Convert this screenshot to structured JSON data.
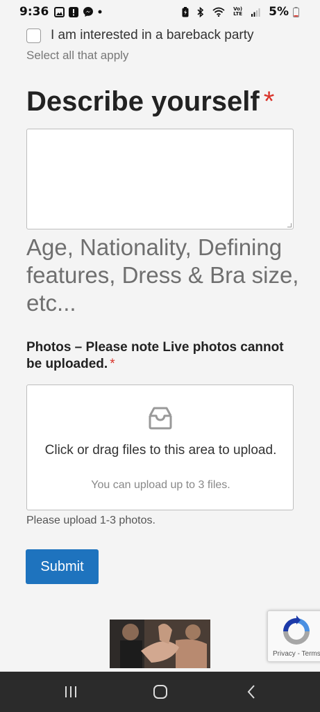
{
  "status_bar": {
    "time": "9:36",
    "lte": "Vo)\nLTE",
    "battery": "5%",
    "icons": [
      "gallery-icon",
      "alert-icon",
      "messenger-icon",
      "dot-icon",
      "battery-saver-icon",
      "bluetooth-icon",
      "wifi-icon",
      "volte-icon",
      "signal-icon",
      "battery-icon"
    ]
  },
  "interest_option": {
    "label": "I am interested in a bareback party",
    "checked": false
  },
  "interest_hint": "Select all that apply",
  "describe": {
    "title": "Describe yourself",
    "required_mark": "*",
    "value": "",
    "help": "Age, Nationality, Defining features, Dress & Bra size, etc..."
  },
  "photos": {
    "label": "Photos – Please note Live photos cannot be uploaded.",
    "required_mark": "*",
    "dropzone_text": "Click or drag files to this area to upload.",
    "dropzone_subtext": "You can upload up to 3 files.",
    "note": "Please upload 1-3 photos."
  },
  "submit_label": "Submit",
  "recaptcha": {
    "privacy": "Privacy",
    "separator": " - ",
    "terms": "Terms"
  },
  "colors": {
    "accent": "#1e73be",
    "required": "#d9342b",
    "background": "#f4f4f4",
    "nav_bar": "#2b2b2b"
  },
  "nav": [
    "recent-apps-icon",
    "home-icon",
    "back-icon"
  ]
}
